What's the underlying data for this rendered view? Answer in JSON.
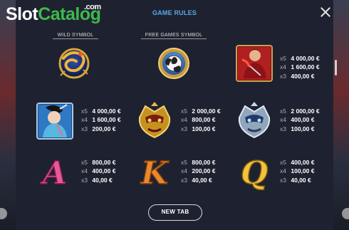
{
  "logo": {
    "part1": "Slot",
    "part2": "Catalog",
    "suffix": ".com"
  },
  "header": {
    "title": "GAME RULES"
  },
  "labels": {
    "wild": "WILD SYMBOL",
    "free_games": "FREE GAMES SYMBOL"
  },
  "paytable": {
    "samurai_red": [
      {
        "mult": "x5",
        "amount": "4 000,00 €"
      },
      {
        "mult": "x4",
        "amount": "1 600,00 €"
      },
      {
        "mult": "x3",
        "amount": "400,00 €"
      }
    ],
    "geisha": [
      {
        "mult": "x5",
        "amount": "4 000,00 €"
      },
      {
        "mult": "x4",
        "amount": "1 600,00 €"
      },
      {
        "mult": "x3",
        "amount": "200,00 €"
      }
    ],
    "gold_mask": [
      {
        "mult": "x5",
        "amount": "2 000,00 €"
      },
      {
        "mult": "x4",
        "amount": "800,00 €"
      },
      {
        "mult": "x3",
        "amount": "100,00 €"
      }
    ],
    "silver_mask": [
      {
        "mult": "x5",
        "amount": "2 000,00 €"
      },
      {
        "mult": "x4",
        "amount": "400,00 €"
      },
      {
        "mult": "x3",
        "amount": "100,00 €"
      }
    ],
    "letter_a": [
      {
        "mult": "x5",
        "amount": "800,00 €"
      },
      {
        "mult": "x4",
        "amount": "400,00 €"
      },
      {
        "mult": "x3",
        "amount": "40,00 €"
      }
    ],
    "letter_k": [
      {
        "mult": "x5",
        "amount": "800,00 €"
      },
      {
        "mult": "x4",
        "amount": "200,00 €"
      },
      {
        "mult": "x3",
        "amount": "40,00 €"
      }
    ],
    "letter_q": [
      {
        "mult": "x5",
        "amount": "400,00 €"
      },
      {
        "mult": "x4",
        "amount": "100,00 €"
      },
      {
        "mult": "x3",
        "amount": "40,00 €"
      }
    ]
  },
  "symbols": {
    "wild": {
      "icon": "dragon-medallion-icon"
    },
    "free_games": {
      "icon": "mitsudomoe-medallion-icon"
    },
    "samurai_red": {
      "icon": "samurai-warrior-icon"
    },
    "geisha": {
      "icon": "geisha-icon"
    },
    "gold_mask": {
      "icon": "gold-samurai-mask-icon"
    },
    "silver_mask": {
      "icon": "silver-samurai-mask-icon"
    },
    "letter_a": {
      "letter": "A",
      "color": "#e8589a"
    },
    "letter_k": {
      "letter": "K",
      "color": "#e8892e"
    },
    "letter_q": {
      "letter": "Q",
      "color": "#f2c23a"
    }
  },
  "button": {
    "label": "NEW TAB"
  },
  "colors": {
    "accent": "#5aa6e8",
    "brand_green": "#3db94a",
    "panel": "#1e2230"
  }
}
